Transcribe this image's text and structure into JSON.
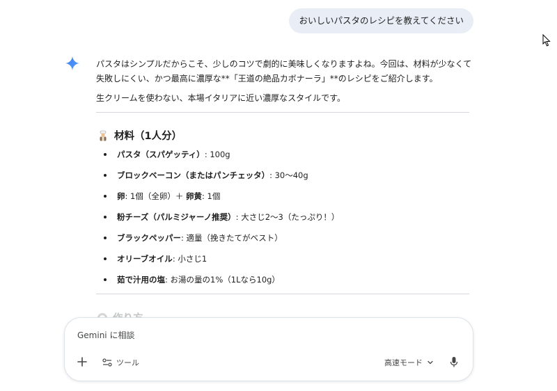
{
  "user_message": "おいしいパスタのレシピを教えてください",
  "response": {
    "intro": "パスタはシンプルだからこそ、少しのコツで劇的に美味しくなりますよね。今回は、材料が少なくて失敗しにくい、かつ最高に濃厚な**「王道の絶品カボナーラ」**のレシピをご紹介します。",
    "subtitle": "生クリームを使わない、本場イタリアに近い濃厚なスタイルです。",
    "ingredients_title": "材料（1人分）",
    "ingredients": [
      {
        "name": "パスタ（スパゲッティ）",
        "detail": ": 100g"
      },
      {
        "name": "ブロックベーコン（またはパンチェッタ）",
        "detail": ": 30〜40g"
      },
      {
        "name": "卵",
        "detail": ": 1個（全卵）＋ ",
        "name2": "卵黄",
        "detail2": ": 1個"
      },
      {
        "name": "粉チーズ（パルミジャーノ推奨）",
        "detail": ": 大さじ2〜3（たっぷり！）"
      },
      {
        "name": "ブラックペッパー",
        "detail": ": 適量（挽きたてがベスト）"
      },
      {
        "name": "オリーブオイル",
        "detail": ": 小さじ1"
      },
      {
        "name": "茹で汁用の塩",
        "detail": ": お湯の量の1%（1Lなら10g）"
      }
    ],
    "next_section_title": "作り方"
  },
  "composer": {
    "placeholder": "Gemini に相談",
    "tools_label": "ツール",
    "mode_label": "高速モード"
  },
  "colors": {
    "user_bubble": "#e9eef6",
    "gemini_blue": "#4285f4"
  }
}
